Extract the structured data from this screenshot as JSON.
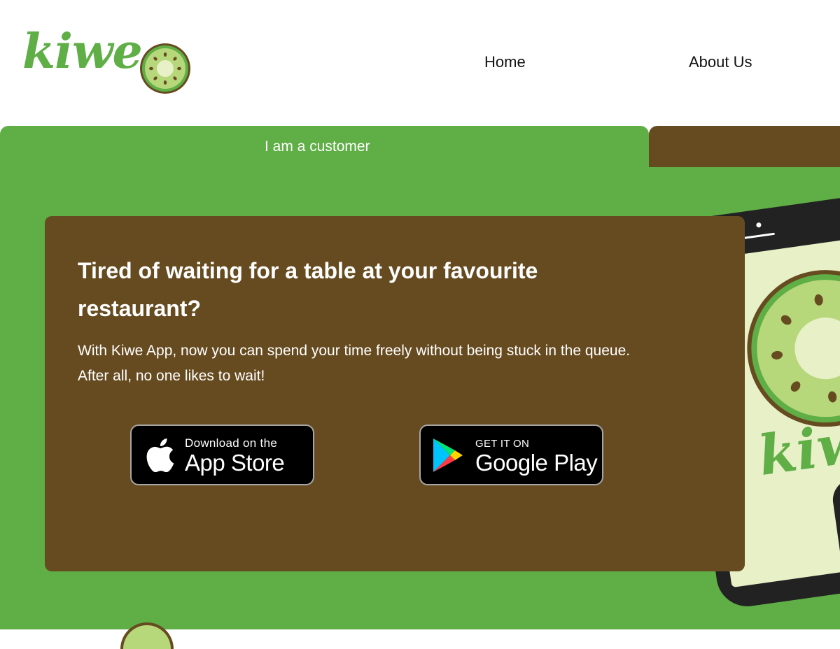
{
  "header": {
    "logo_text": "kiwe",
    "nav": [
      {
        "label": "Home"
      },
      {
        "label": "About Us"
      }
    ]
  },
  "tabs": {
    "customer_label": "I am a customer"
  },
  "hero": {
    "headline": "Tired of waiting for a table at your favourite restaurant?",
    "description": "With Kiwe App, now you can spend your time freely without being stuck in the queue. After all, no one likes to wait!"
  },
  "badges": {
    "apple": {
      "small": "Download on the",
      "big": "App Store",
      "icon": "apple-icon"
    },
    "google": {
      "small": "GET IT ON",
      "big": "Google Play",
      "icon": "google-play-icon"
    }
  },
  "phone": {
    "screen_logo": "kiwe"
  },
  "colors": {
    "brand_green": "#5fae46",
    "brand_brown": "#674b20",
    "kiwi_light": "#b6d77a",
    "screen_bg": "#e8f0c8"
  }
}
